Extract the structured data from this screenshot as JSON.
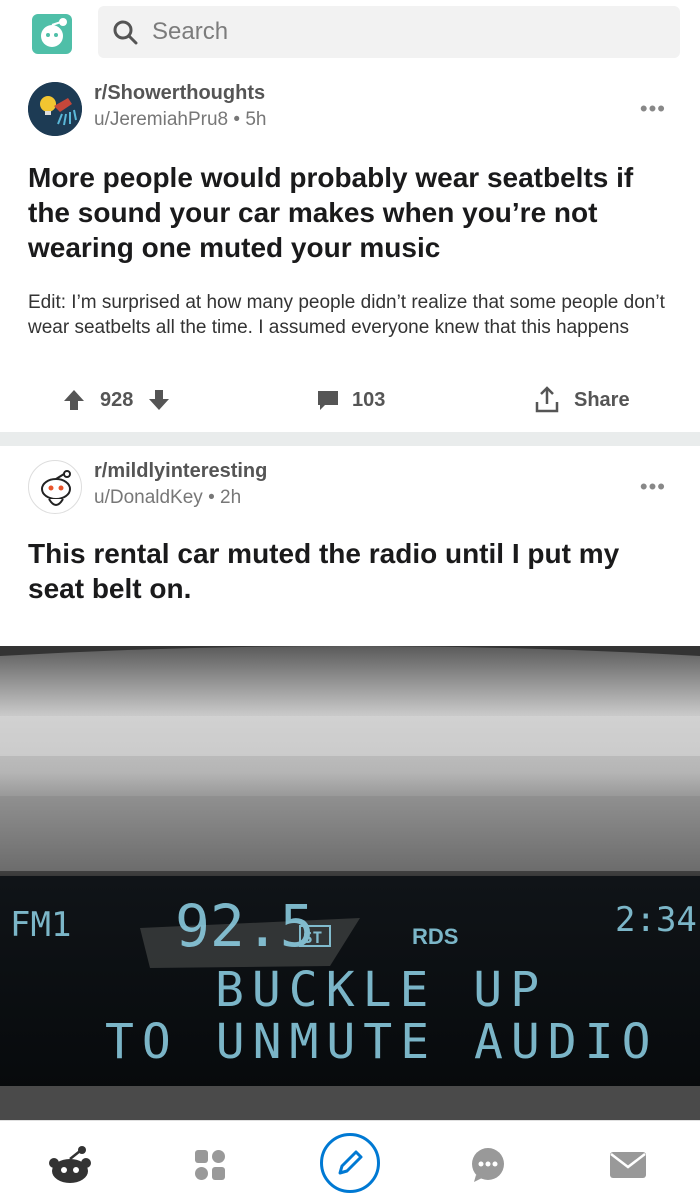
{
  "search": {
    "placeholder": "Search"
  },
  "posts": [
    {
      "subreddit": "r/Showerthoughts",
      "author": "u/JeremiahPru8",
      "age": "5h",
      "title": "More people would probably wear seatbelts if the sound your car makes when you’re not wearing one muted your music",
      "body": "Edit: I’m surprised at how many people didn’t realize that some people don’t wear seatbelts all the time. I assumed everyone knew that this happens",
      "votes": "928",
      "comments": "103",
      "share_label": "Share"
    },
    {
      "subreddit": "r/mildlyinteresting",
      "author": "u/DonaldKey",
      "age": "2h",
      "title": "This rental car muted the radio until I put my seat belt on."
    }
  ],
  "radio_display": {
    "band": "FM1",
    "frequency": "92.5",
    "stereo": "ST",
    "rds": "RDS",
    "clock": "2:34",
    "line1": "BUCKLE UP",
    "line2": "TO UNMUTE AUDIO"
  },
  "colors": {
    "accent_blue": "#0079d3",
    "text_dark": "#1a1a1b",
    "lcd_text": "#8fd3e8"
  },
  "bottom_nav": [
    {
      "icon": "reddit-home-icon"
    },
    {
      "icon": "grid-communities-icon"
    },
    {
      "icon": "pencil-create-icon"
    },
    {
      "icon": "chat-icon"
    },
    {
      "icon": "mail-icon"
    }
  ]
}
